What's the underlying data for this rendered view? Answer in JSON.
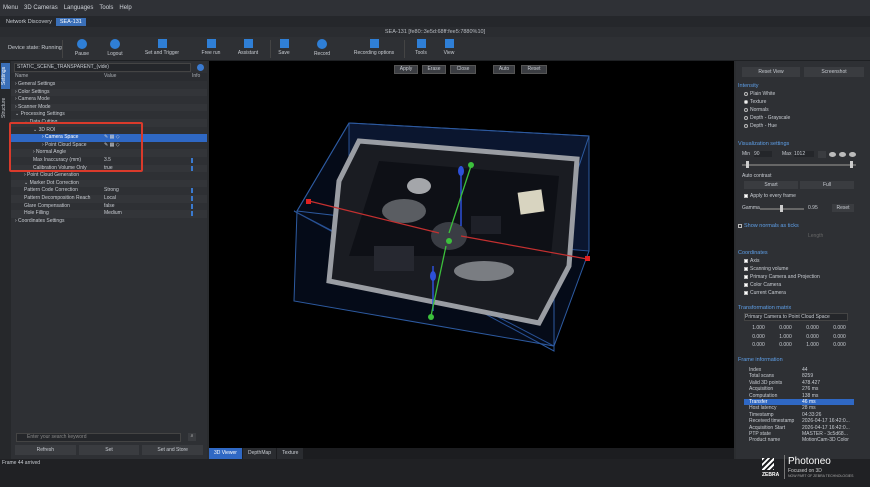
{
  "menu": [
    "Menu",
    "3D Cameras",
    "Languages",
    "Tools",
    "Help"
  ],
  "tabs": [
    "Network Discovery",
    "SEA-131"
  ],
  "window_title": "SEA-131 [fe80::3e5d:68ff:fee5:7880%10]",
  "toolbar": {
    "device_state": "Device state: Running",
    "buttons": [
      "Pause",
      "Logout",
      "Set and Trigger",
      "Free run",
      "Assistant",
      "Save",
      "Record",
      "Recording options",
      "Tools",
      "View"
    ]
  },
  "side_tabs": [
    "Settings",
    "Structure"
  ],
  "settings": {
    "profile": "STATIC_SCENE_TRANSPARENT_(vide)",
    "col_name": "Name",
    "col_value": "Value",
    "col_info": "Info",
    "rows": [
      {
        "indent": 0,
        "label": "› General Settings",
        "value": ""
      },
      {
        "indent": 0,
        "label": "› Color Settings",
        "value": ""
      },
      {
        "indent": 0,
        "label": "› Camera Mode",
        "value": ""
      },
      {
        "indent": 0,
        "label": "› Scanner Mode",
        "value": ""
      },
      {
        "indent": 0,
        "label": "⌄ Processing Settings",
        "value": ""
      },
      {
        "indent": 1,
        "label": "⌄ Data Cutting",
        "value": ""
      },
      {
        "indent": 2,
        "label": "⌄ 3D ROI",
        "value": ""
      },
      {
        "indent": 3,
        "label": "› Camera Space",
        "value": "",
        "icons": true,
        "selected": true
      },
      {
        "indent": 3,
        "label": "› Point Cloud Space",
        "value": "",
        "icons": true
      },
      {
        "indent": 2,
        "label": "› Normal Angle",
        "value": ""
      },
      {
        "indent": 2,
        "label": "Max Inaccuracy (mm)",
        "value": "3.5",
        "blue": true
      },
      {
        "indent": 2,
        "label": "Calibration Volume Only",
        "value": "true",
        "blue": true
      },
      {
        "indent": 1,
        "label": "› Point Cloud Generation",
        "value": ""
      },
      {
        "indent": 1,
        "label": "⌄ Marker Dot Correction",
        "value": ""
      },
      {
        "indent": 1,
        "label": "Pattern Code Correction",
        "value": "Strong",
        "blue": true
      },
      {
        "indent": 1,
        "label": "Pattern Decomposition Reach",
        "value": "Local",
        "blue": true
      },
      {
        "indent": 1,
        "label": "Glare Compensation",
        "value": "false",
        "blue": true
      },
      {
        "indent": 1,
        "label": "Hole Filling",
        "value": "Medium",
        "blue": true
      },
      {
        "indent": 0,
        "label": "› Coordinates Settings",
        "value": ""
      }
    ],
    "search_placeholder": "Enter your search keyword",
    "buttons": [
      "Refresh",
      "Set",
      "Set and Store"
    ]
  },
  "viewer": {
    "top_buttons": [
      "Apply",
      "Erase",
      "Close",
      "Auto",
      "Reset"
    ],
    "bottom_tabs": [
      "3D Viewer",
      "DepthMap",
      "Texture"
    ]
  },
  "right": {
    "reset_view": "Reset View",
    "screenshot": "Screenshot",
    "intensity_title": "Intensity",
    "intensity_options": [
      "Plain White",
      "Texture",
      "Normals",
      "Depth - Grayscale",
      "Depth - Hue"
    ],
    "vis_title": "Visualization settings",
    "min_label": "Min",
    "min_val": "90",
    "max_label": "Max",
    "max_val": "1012",
    "auto_contrast": "Auto contrast",
    "smart": "Smart",
    "full": "Full",
    "apply_every": "Apply to every frame",
    "gamma_label": "Gamma",
    "gamma_val": "0.95",
    "reset": "Reset",
    "normals_ticks": "Show normals as ticks",
    "length_label": "Length",
    "coords_title": "Coordinates",
    "coords_options": [
      "Axis",
      "Scanning volume",
      "Primary Camera and Projection",
      "Color Camera",
      "Current Camera"
    ],
    "transform_title": "Transformation matrix",
    "transform_select": "Primary Camera to Point Cloud Space",
    "matrix": [
      [
        "1.000",
        "0.000",
        "0.000",
        "0.000"
      ],
      [
        "0.000",
        "1.000",
        "0.000",
        "0.000"
      ],
      [
        "0.000",
        "0.000",
        "1.000",
        "0.000"
      ]
    ],
    "frame_title": "Frame information",
    "frame_rows": [
      [
        "Index",
        "44"
      ],
      [
        "Total scans",
        "8259"
      ],
      [
        "Valid 3D points",
        "478.427"
      ],
      [
        "Acquisition",
        "276 ms"
      ],
      [
        "Computation",
        "138 ms"
      ],
      [
        "Transfer",
        "46 ms"
      ],
      [
        "Host latency",
        "28 ms"
      ],
      [
        "Timestamp",
        "04:33:26"
      ],
      [
        "Received timestamp",
        "2026-04-17 16:42:0..."
      ],
      [
        "Acquisition Start",
        "2026-04-17 16:42:0..."
      ],
      [
        "PTP state",
        "MASTER - 3c5d68..."
      ],
      [
        "Product name",
        "MotionCam-3D Color"
      ]
    ]
  },
  "status": "Frame 44 arrived",
  "brand": {
    "zebra": "ZEBRA",
    "photoneo": "Photoneo",
    "tagline": "Focused on 3D",
    "sub": "NOW PART OF ZEBRA TECHNOLOGIES"
  },
  "colors": {
    "accent": "#2f68c4",
    "section": "#5e9fe8",
    "roi_box": "#2d5aa0",
    "highlight": "#d93a2b"
  }
}
